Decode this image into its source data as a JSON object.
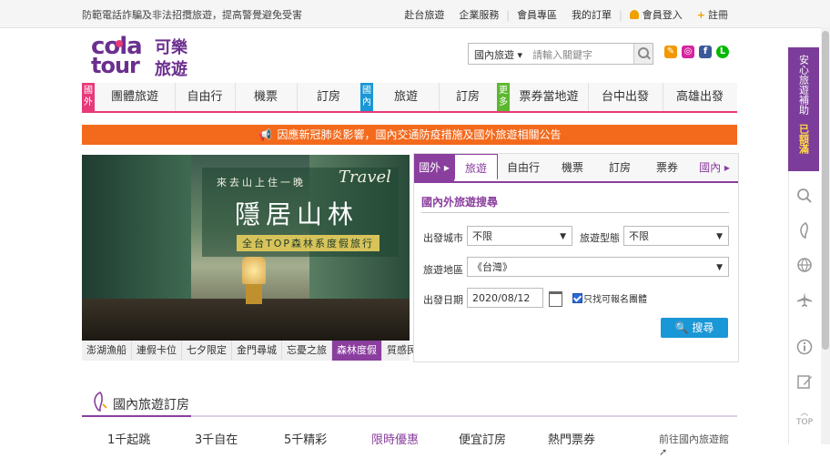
{
  "topbar": {
    "warning": "防範電話詐騙及非法招攬旅遊，提高警覺避免受害",
    "links": [
      "赴台旅遊",
      "企業服務",
      "會員專區",
      "我的訂單"
    ],
    "login": "會員登入",
    "register": "註冊"
  },
  "logo": {
    "cola": "cola",
    "tour": "tour",
    "kele": "可樂",
    "lvyou": "旅遊"
  },
  "search": {
    "category": "國內旅遊 ▾",
    "placeholder": "請輸入關鍵字"
  },
  "social": [
    {
      "icon": "tag-icon",
      "color": "#f39800"
    },
    {
      "icon": "instagram-icon",
      "color": "#d6249f"
    },
    {
      "icon": "facebook-icon",
      "color": "#3b5998"
    },
    {
      "icon": "line-icon",
      "color": "#00b900"
    }
  ],
  "nav": {
    "tag_outbound": "國外",
    "tag_domestic": "國內",
    "tag_more": "更多",
    "items": [
      "團體旅遊",
      "自由行",
      "機票",
      "訂房",
      "旅遊",
      "訂房",
      "票券當地遊",
      "台中出發",
      "高雄出發"
    ]
  },
  "alert": "因應新冠肺炎影響，國內交通防疫措施及國外旅遊相關公告",
  "hero": {
    "line1": "來去山上住一晚",
    "script": "Travel",
    "main": "隱居山林",
    "sub": "全台TOP森林系度假旅行"
  },
  "hero_tabs": [
    "澎湖漁船",
    "連假卡位",
    "七夕限定",
    "金門尋城",
    "忘憂之旅",
    "森林度假",
    "質感民宿"
  ],
  "hero_active": "森林度假",
  "panel": {
    "tabs": [
      "國外 ▸",
      "旅遊",
      "自由行",
      "機票",
      "訂房",
      "票券",
      "國內 ▸"
    ],
    "title": "國內外旅遊搜尋",
    "origin_label": "出發城市",
    "origin_value": "不限",
    "type_label": "旅遊型態",
    "type_value": "不限",
    "region_label": "旅遊地區",
    "region_value": "《台灣》",
    "date_label": "出發日期",
    "date_value": "2020/08/12",
    "only_available": "只找可報名團體",
    "search_btn": "搜尋"
  },
  "section": {
    "title": "國內旅遊訂房",
    "tabs": [
      "1千起跳",
      "3千自在",
      "5千精彩",
      "限時優惠",
      "便宜訂房",
      "熱門票券"
    ],
    "active": "限時優惠",
    "more": "前往國內旅遊館"
  },
  "promo": {
    "l1": "安心旅遊補助",
    "l2": "已額滿"
  },
  "rail": {
    "top": "TOP"
  },
  "colors": {
    "purple": "#8a3e9e",
    "pink": "#e8397a",
    "orange": "#f46a1c",
    "blue": "#1a97d6",
    "green": "#5bb82e"
  }
}
